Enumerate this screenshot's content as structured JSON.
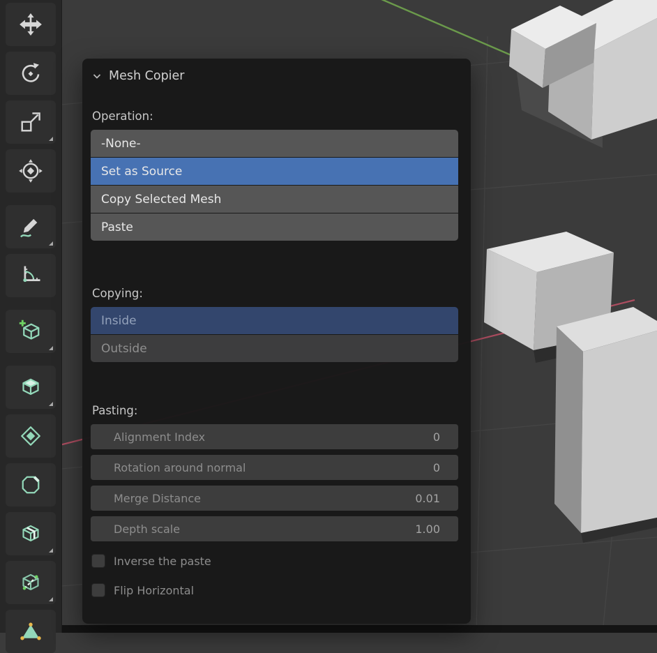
{
  "colors": {
    "viewport_bg": "#3b3b3b",
    "selected_blue": "#4772b3",
    "tool_teal": "#93d8b9",
    "axis_green": "#6b9a4b",
    "axis_red": "#ad4d60"
  },
  "toolbar": {
    "tools": [
      {
        "name": "move",
        "icon": "move-icon",
        "has_submenu": false
      },
      {
        "name": "rotate",
        "icon": "rotate-icon",
        "has_submenu": false
      },
      {
        "name": "scale",
        "icon": "scale-icon",
        "has_submenu": true
      },
      {
        "name": "transform",
        "icon": "transform-icon",
        "has_submenu": false
      },
      {
        "name": "annotate",
        "icon": "annotate-pencil-icon",
        "has_submenu": true
      },
      {
        "name": "measure",
        "icon": "measure-icon",
        "has_submenu": false
      },
      {
        "name": "add-cube",
        "icon": "add-cube-icon",
        "has_submenu": true
      },
      {
        "name": "extrude-region",
        "icon": "extrude-region-icon",
        "has_submenu": true
      },
      {
        "name": "inset-faces",
        "icon": "inset-faces-icon",
        "has_submenu": false
      },
      {
        "name": "bevel",
        "icon": "bevel-icon",
        "has_submenu": false
      },
      {
        "name": "loop-cut",
        "icon": "loop-cut-icon",
        "has_submenu": true
      },
      {
        "name": "knife",
        "icon": "knife-icon",
        "has_submenu": true
      },
      {
        "name": "poly-build",
        "icon": "poly-build-icon",
        "has_submenu": false
      }
    ]
  },
  "panel": {
    "title": "Mesh Copier",
    "chevron_icon": "chevron-down-icon",
    "operation": {
      "label": "Operation:",
      "options": [
        {
          "label": "-None-",
          "state": "normal"
        },
        {
          "label": "Set as Source",
          "state": "selected"
        },
        {
          "label": "Copy Selected Mesh",
          "state": "normal"
        },
        {
          "label": "Paste",
          "state": "normal"
        }
      ]
    },
    "copying": {
      "label": "Copying:",
      "options": [
        {
          "label": "Inside",
          "state": "selected-muted"
        },
        {
          "label": "Outside",
          "state": "muted"
        }
      ]
    },
    "pasting": {
      "label": "Pasting:",
      "fields": [
        {
          "label": "Alignment Index",
          "value": "0"
        },
        {
          "label": "Rotation around normal",
          "value": "0"
        },
        {
          "label": "Merge Distance",
          "value": "0.01"
        },
        {
          "label": "Depth scale",
          "value": "1.00"
        }
      ],
      "checkboxes": [
        {
          "label": "Inverse the paste",
          "checked": false
        },
        {
          "label": "Flip Horizontal",
          "checked": false
        }
      ]
    }
  }
}
